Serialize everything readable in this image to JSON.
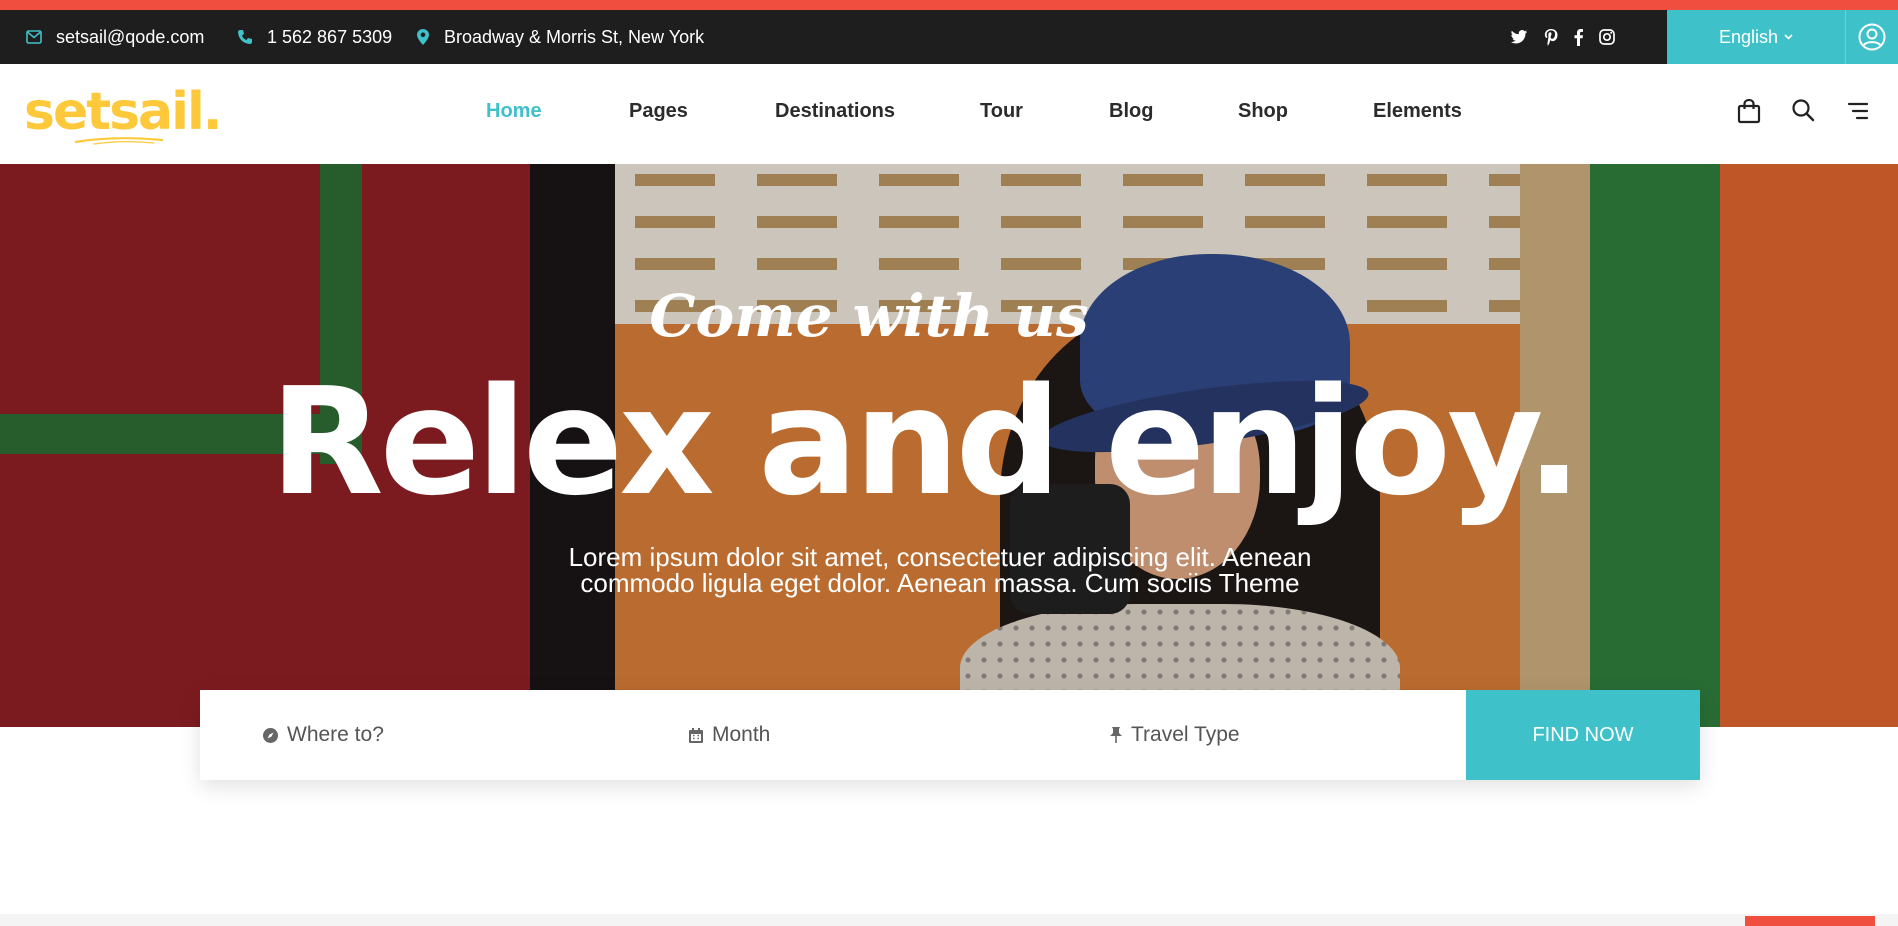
{
  "topbar": {
    "email": "setsail@qode.com",
    "phone": "1 562 867 5309",
    "address": "Broadway & Morris St, New York",
    "language": "English"
  },
  "logo": {
    "text": "setsail."
  },
  "nav": {
    "items": [
      {
        "label": "Home",
        "active": true
      },
      {
        "label": "Pages"
      },
      {
        "label": "Destinations"
      },
      {
        "label": "Tour"
      },
      {
        "label": "Blog"
      },
      {
        "label": "Shop"
      },
      {
        "label": "Elements"
      }
    ]
  },
  "hero": {
    "pretitle": "Come with us",
    "title": "Relex and enjoy.",
    "subtitle": "Lorem ipsum dolor sit amet, consectetuer adipiscing elit. Aenean commodo ligula eget dolor. Aenean massa. Cum sociis Theme"
  },
  "search": {
    "where_placeholder": "Where to?",
    "month_placeholder": "Month",
    "type_placeholder": "Travel Type",
    "button_label": "FIND NOW"
  },
  "colors": {
    "accent": "#3fc1c9",
    "logo": "#fdc93a",
    "topbar_bg": "#1e1e1e",
    "strip_red": "#f04e3e"
  }
}
